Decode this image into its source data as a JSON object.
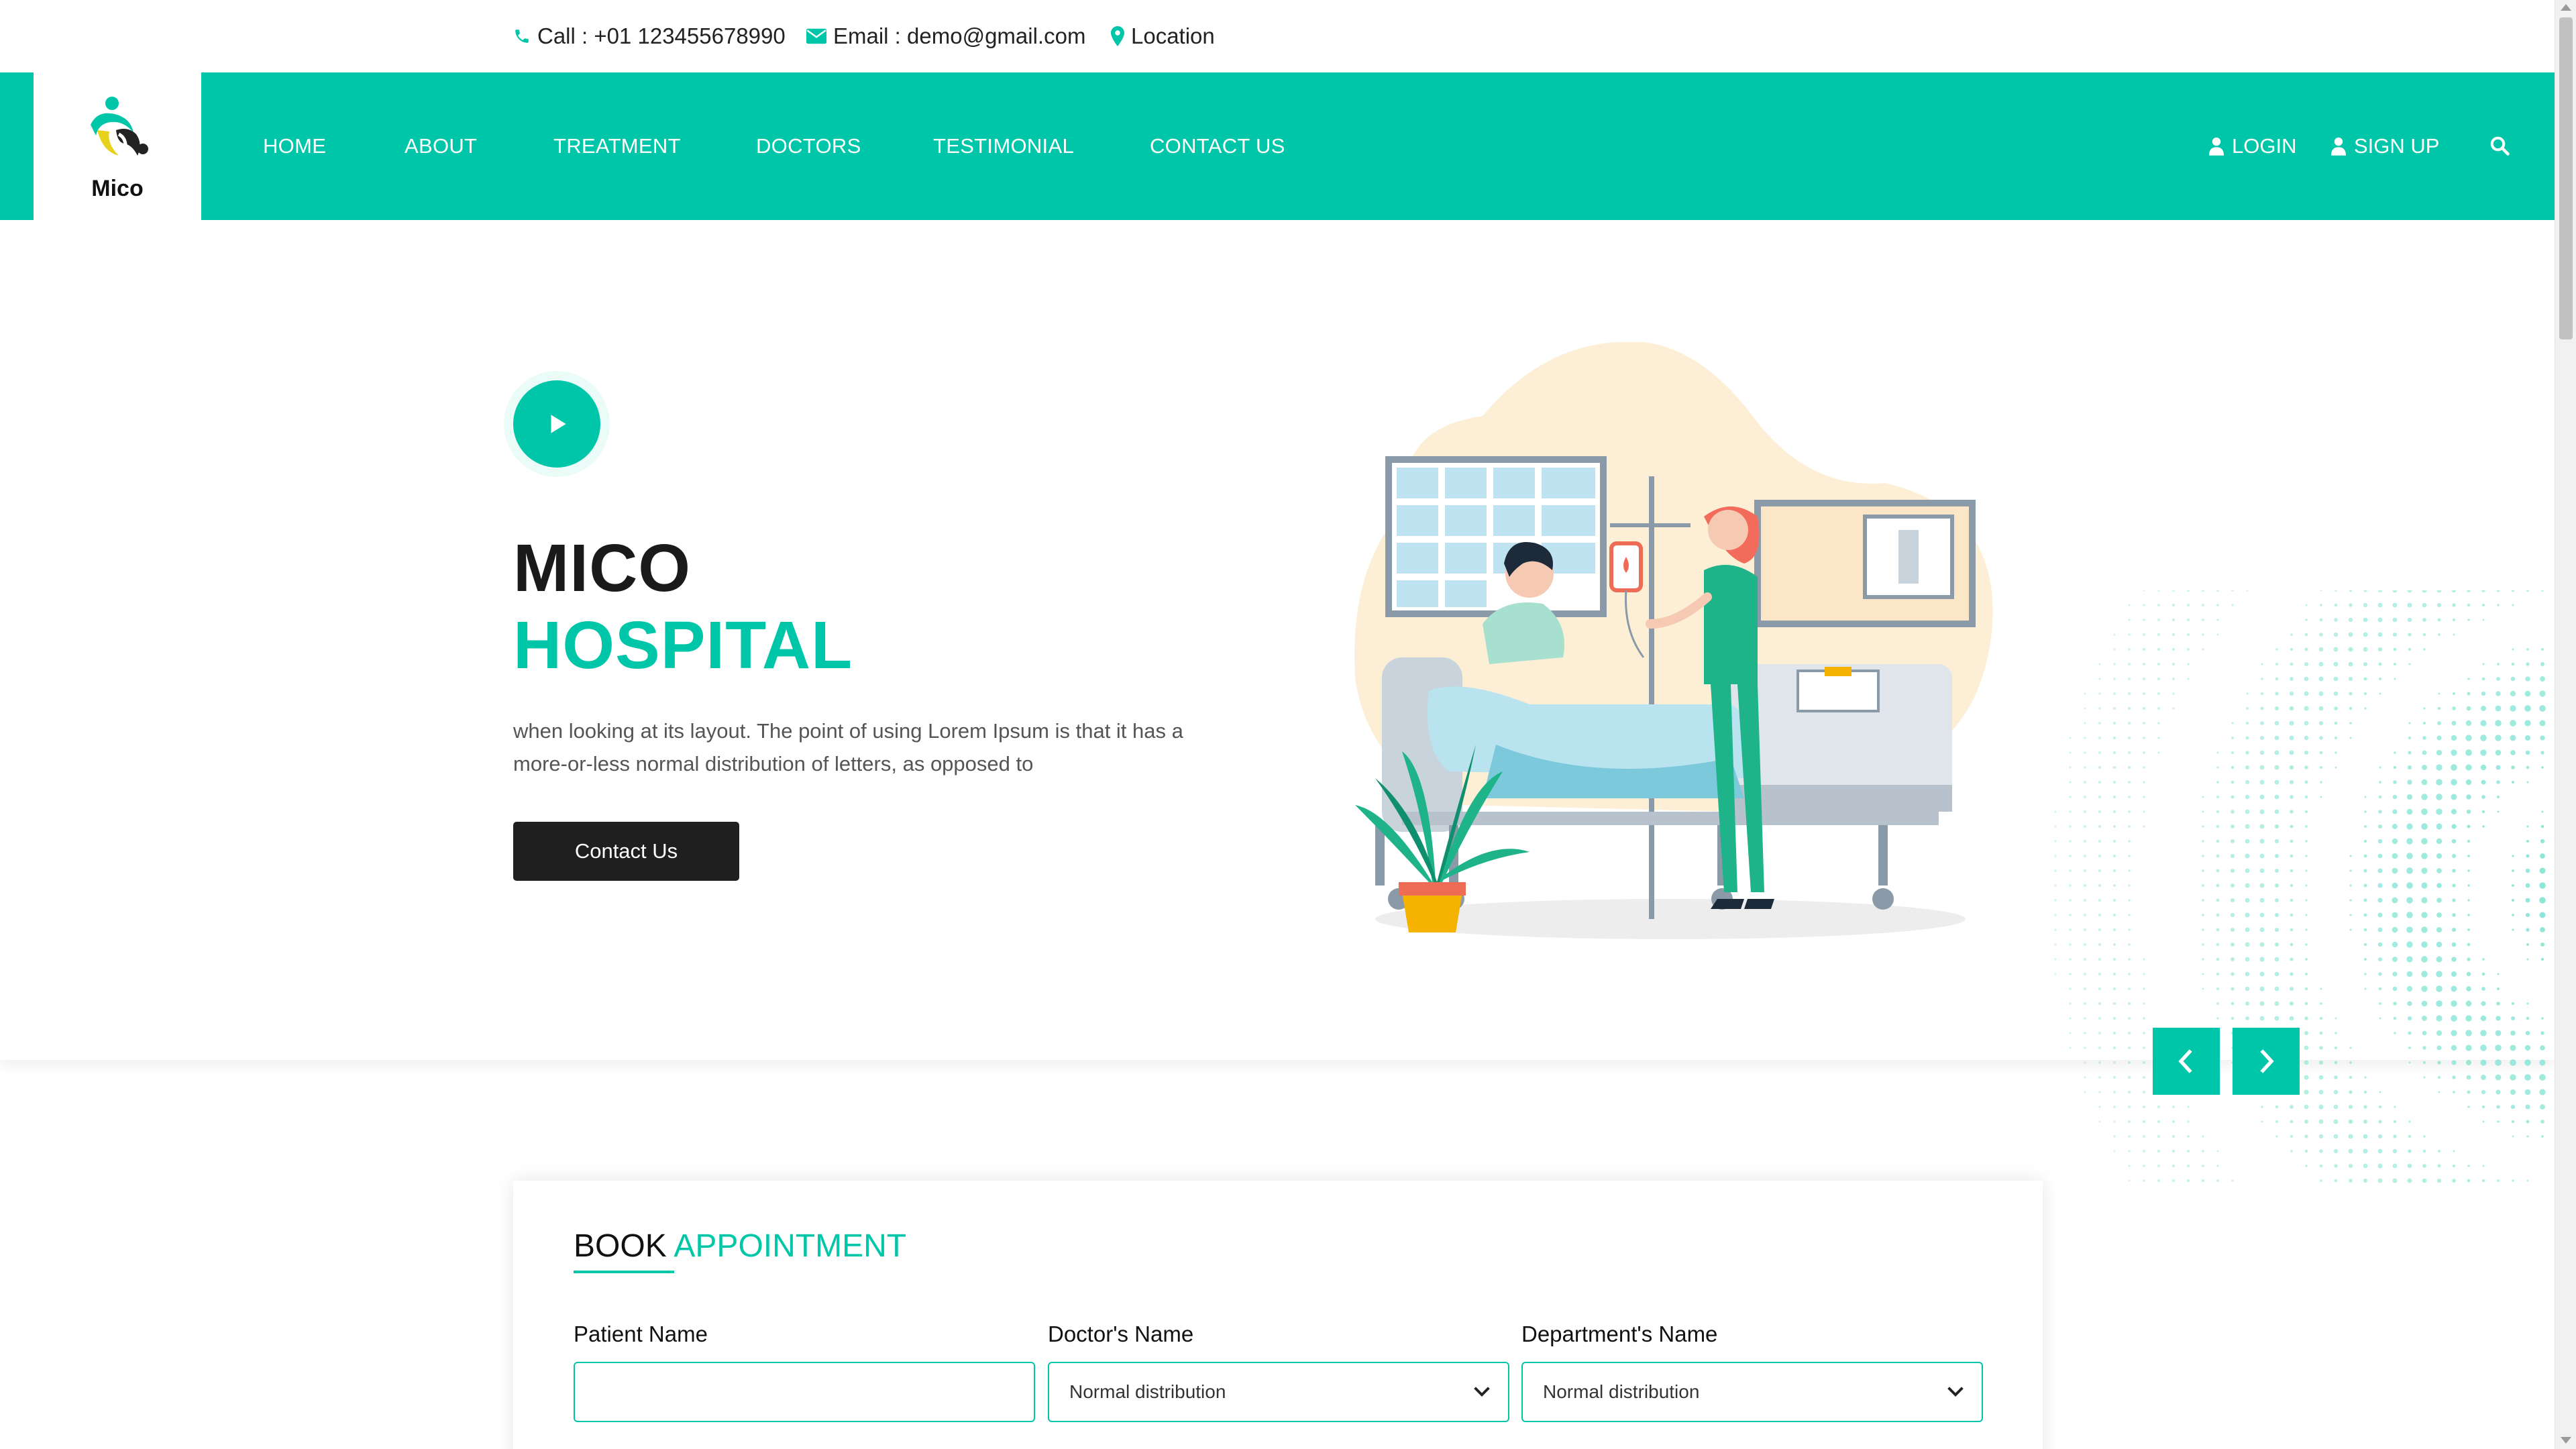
{
  "topbar": {
    "call": "Call : +01 123455678990",
    "email": "Email : demo@gmail.com",
    "location": "Location"
  },
  "brand": {
    "name": "Mico"
  },
  "nav": {
    "items": [
      {
        "label": "HOME"
      },
      {
        "label": "ABOUT"
      },
      {
        "label": "TREATMENT"
      },
      {
        "label": "DOCTORS"
      },
      {
        "label": "TESTIMONIAL"
      },
      {
        "label": "CONTACT US"
      }
    ],
    "login": "LOGIN",
    "signup": "SIGN UP"
  },
  "hero": {
    "title_line1": "MICO",
    "title_line2": "HOSPITAL",
    "text": "when looking at its layout. The point of using Lorem Ipsum is that it has a more-or-less normal distribution of letters, as opposed to",
    "button": "Contact Us"
  },
  "booking": {
    "title_dark": "BOOK",
    "title_accent": "APPOINTMENT",
    "fields": [
      {
        "label": "Patient Name",
        "value": ""
      },
      {
        "label": "Doctor's Name",
        "value": "Normal distribution"
      },
      {
        "label": "Department's Name",
        "value": "Normal distribution"
      }
    ]
  },
  "icons": {
    "phone": "phone-icon",
    "email": "envelope-icon",
    "location": "map-marker-icon",
    "user": "user-icon",
    "search": "search-icon",
    "play": "play-icon",
    "prev": "chevron-left-icon",
    "next": "chevron-right-icon",
    "dropdown": "chevron-down-icon"
  },
  "colors": {
    "accent": "#00c6a9",
    "dark": "#1f1f1f"
  }
}
